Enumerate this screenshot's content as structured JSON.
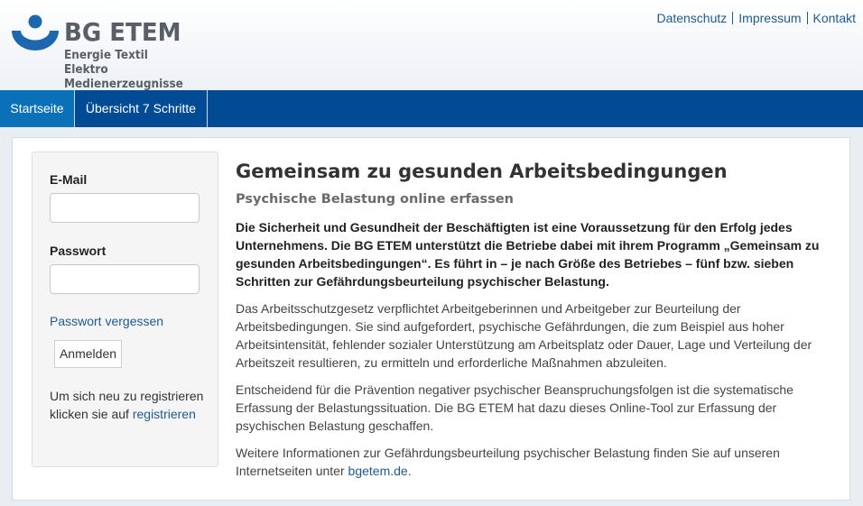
{
  "brand": {
    "title": "BG ETEM",
    "subtitle_line1": "Energie Textil Elektro",
    "subtitle_line2": "Medienerzeugnisse",
    "color": "#1c67ae"
  },
  "toplinks": {
    "privacy": "Datenschutz",
    "imprint": "Impressum",
    "contact": "Kontakt"
  },
  "nav": {
    "home": "Startseite",
    "overview": "Übersicht 7 Schritte"
  },
  "login": {
    "email_label": "E-Mail",
    "password_label": "Passwort",
    "forgot": "Passwort vergessen",
    "submit": "Anmelden",
    "register_text": "Um sich neu zu registrieren klicken sie auf",
    "register_link": "registrieren"
  },
  "main": {
    "heading": "Gemeinsam zu gesunden Arbeitsbedingungen",
    "subheading": "Psychische Belastung online erfassen",
    "lead": "Die Sicherheit und Gesundheit der Beschäftigten ist eine Voraussetzung für den Erfolg jedes Unternehmens. Die BG ETEM unterstützt die Betriebe dabei mit ihrem Programm „Gemeinsam zu gesunden Arbeitsbedingungen“. Es führt in – je nach Größe des Betriebes – fünf bzw. sieben Schritten zur Gefährdungsbeurteilung psychischer Belastung.",
    "para1": "Das Arbeitsschutzgesetz verpflichtet Arbeitgeberinnen und Arbeitgeber zur Beurteilung der Arbeitsbedingungen. Sie sind aufgefordert, psychische Gefährdungen, die zum Beispiel aus hoher Arbeitsintensität, fehlender sozialer Unterstützung am Arbeitsplatz oder Dauer, Lage und Verteilung der Arbeitszeit resultieren, zu ermitteln und erforderliche Maßnahmen abzuleiten.",
    "para2": "Entscheidend für die Prävention negativer psychischer Beanspruchungsfolgen ist die systematische Erfassung der Belastungssituation. Die BG ETEM hat dazu dieses Online-Tool zur Erfassung der psychischen Belastung geschaffen.",
    "para3_text": "Weitere Informationen zur Gefährdungsbeurteilung psychischer Belastung finden Sie auf unseren Internetseiten unter",
    "para3_link": "bgetem.de",
    "para3_end": "."
  }
}
